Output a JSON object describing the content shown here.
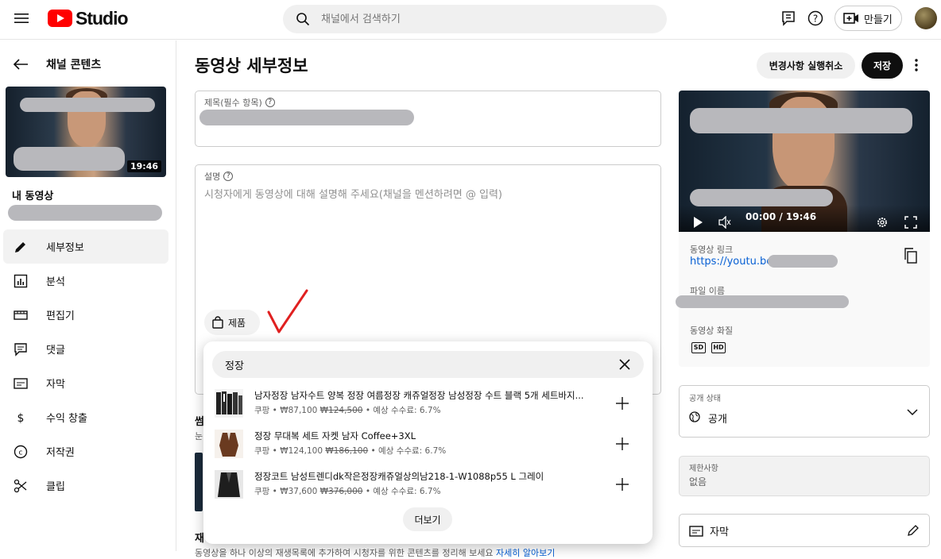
{
  "header": {
    "logo_text": "Studio",
    "search_placeholder": "채널에서 검색하기",
    "create_label": "만들기"
  },
  "sidebar": {
    "back_label": "채널 콘텐츠",
    "duration": "19:46",
    "my_video_label": "내 동영상",
    "items": [
      {
        "label": "세부정보",
        "icon": "pencil-icon",
        "active": true
      },
      {
        "label": "분석",
        "icon": "analytics-icon"
      },
      {
        "label": "편집기",
        "icon": "editor-icon"
      },
      {
        "label": "댓글",
        "icon": "comments-icon"
      },
      {
        "label": "자막",
        "icon": "subtitles-icon"
      },
      {
        "label": "수익 창출",
        "icon": "monetization-icon"
      },
      {
        "label": "저작권",
        "icon": "copyright-icon"
      },
      {
        "label": "클립",
        "icon": "clip-icon"
      }
    ]
  },
  "main": {
    "page_title": "동영상 세부정보",
    "undo_label": "변경사항 실행취소",
    "save_label": "저장",
    "title_label": "제목(필수 항목)",
    "desc_label": "설명",
    "desc_placeholder": "시청자에게 동영상에 대해 설명해 주세요(채널을 멘션하려면 @ 입력)",
    "product_chip": "제품",
    "thumb_section_partial": "썸",
    "thumb_sub_partial": "눈",
    "playlist_partial": "재",
    "playlist_desc_partial": "동영상을 하나 이상의 재생목록에 추가하여 시청자를 위한 콘텐츠를 정리해 보세요",
    "playlist_link_partial": "자세히 알아보기"
  },
  "product_popup": {
    "query": "정장",
    "more_label": "더보기",
    "products": [
      {
        "name": "남자정장 남자수트 양복 정장 여름정장 캐쥬얼정장 남성정장 수트 블랙 5개 세트바지...",
        "seller": "쿠팡",
        "price": "₩87,100",
        "original_price": "₩124,500",
        "fee": "예상 수수료: 6.7%"
      },
      {
        "name": "정장 무대복 세트 자켓 남자 Coffee+3XL",
        "seller": "쿠팡",
        "price": "₩124,100",
        "original_price": "₩186,100",
        "fee": "예상 수수료: 6.7%"
      },
      {
        "name": "정장코트 남성트렌디dk작은정장캐쥬얼상의남218-1-W1088p55 L 그레이",
        "seller": "쿠팡",
        "price": "₩37,600",
        "original_price": "₩376,000",
        "fee": "예상 수수료: 6.7%"
      }
    ]
  },
  "preview": {
    "time": "00:00 / 19:46",
    "link_label": "동영상 링크",
    "link_prefix": "https://youtu.be/",
    "file_label": "파일 이름",
    "quality_label": "동영상 화질",
    "sd": "SD",
    "hd": "HD"
  },
  "visibility": {
    "label": "공개 상태",
    "value": "공개"
  },
  "restrictions": {
    "label": "제한사항",
    "value": "없음"
  },
  "subtitles": {
    "label": "자막"
  },
  "colors": {
    "accent_red": "#ff0000",
    "link_blue": "#065fd4",
    "check_red": "#e02020"
  }
}
